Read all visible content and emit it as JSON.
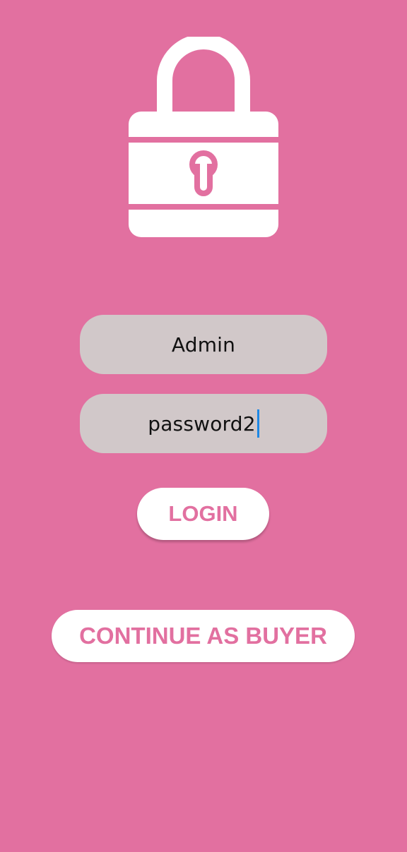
{
  "theme": {
    "background": "#e270a0",
    "field_background": "#d1c8c9",
    "button_background": "#ffffff",
    "button_text": "#e270a0",
    "caret_color": "#1e88e5"
  },
  "header": {
    "icon": "padlock-icon"
  },
  "form": {
    "username": {
      "value": "Admin"
    },
    "password": {
      "value": "password2"
    },
    "login_label": "LOGIN",
    "buyer_label": "CONTINUE AS BUYER"
  }
}
